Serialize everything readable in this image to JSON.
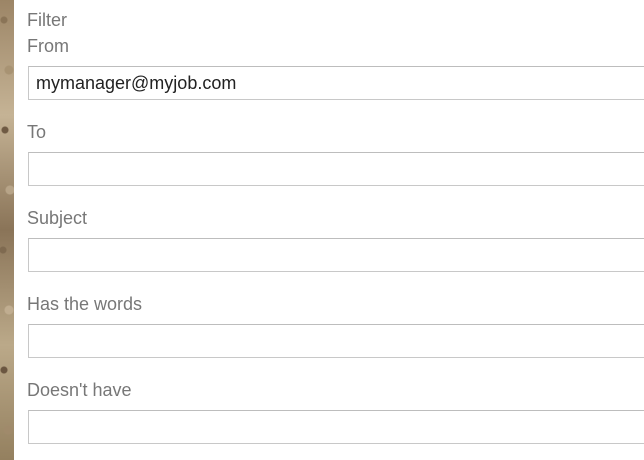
{
  "filter": {
    "heading": "Filter",
    "fields": [
      {
        "label": "From",
        "value": "mymanager@myjob.com"
      },
      {
        "label": "To",
        "value": ""
      },
      {
        "label": "Subject",
        "value": ""
      },
      {
        "label": "Has the words",
        "value": ""
      },
      {
        "label": "Doesn't have",
        "value": ""
      }
    ]
  }
}
